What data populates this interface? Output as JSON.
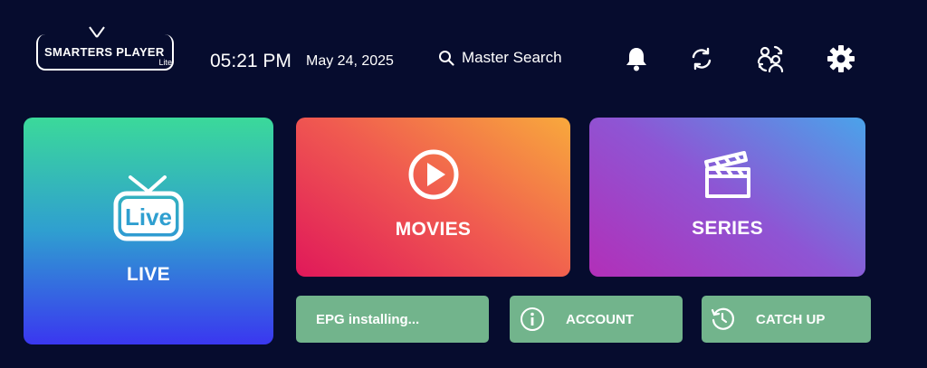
{
  "header": {
    "logo_title": "SMARTERS PLAYER",
    "logo_sub": "Lite",
    "time": "05:21 PM",
    "date": "May 24, 2025",
    "search_label": "Master Search",
    "icons": [
      "bell-icon",
      "refresh-icon",
      "switch-user-icon",
      "gear-icon"
    ]
  },
  "tiles": {
    "live": "LIVE",
    "live_badge": "Live",
    "movies": "MOVIES",
    "series": "SERIES"
  },
  "bottom": {
    "epg": "EPG installing...",
    "account": "ACCOUNT",
    "catchup": "CATCH UP"
  },
  "colors": {
    "background": "#060c2e",
    "small_button": "#72b48c"
  }
}
